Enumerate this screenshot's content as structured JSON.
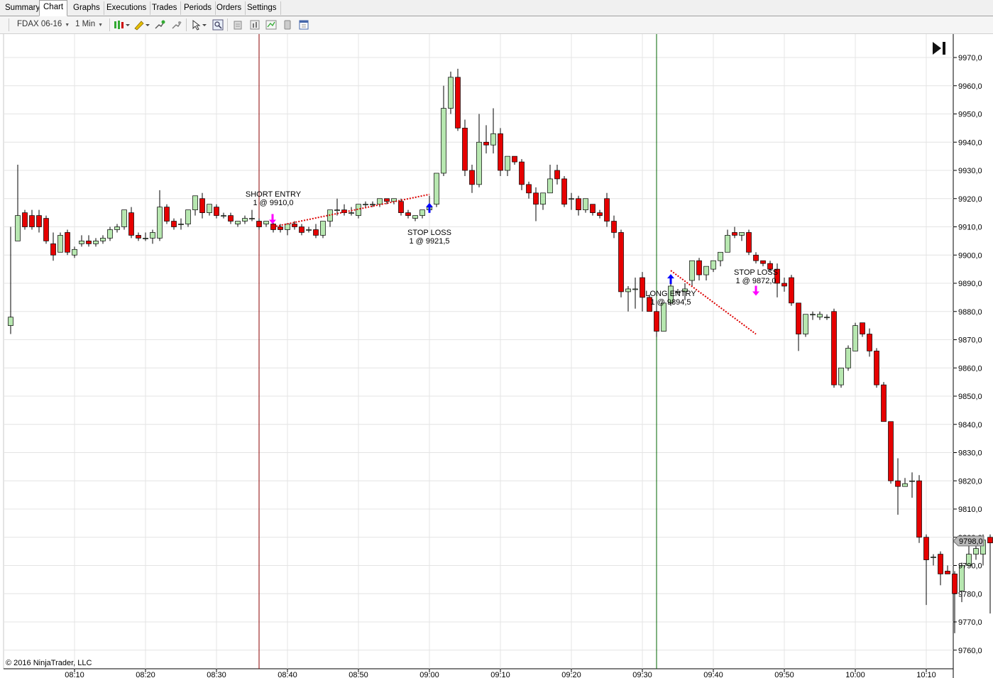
{
  "tabs": [
    {
      "label": "Summary",
      "active": false
    },
    {
      "label": "Chart",
      "active": true
    },
    {
      "label": "Graphs",
      "active": false
    },
    {
      "label": "Executions",
      "active": false
    },
    {
      "label": "Trades",
      "active": false
    },
    {
      "label": "Periods",
      "active": false
    },
    {
      "label": "Orders",
      "active": false
    },
    {
      "label": "Settings",
      "active": false
    }
  ],
  "toolbar": {
    "instrument": "FDAX 06-16",
    "interval": "1 Min",
    "icons": [
      "candlestick-style-icon",
      "pencil-draw-icon",
      "indicator-add-icon",
      "strategy-icon",
      "cursor-select-icon",
      "zoom-icon",
      "data-box-icon",
      "chart-properties-icon",
      "chart-trader-icon",
      "templates-icon",
      "panel-icon"
    ]
  },
  "chart": {
    "copyright": "© 2016 NinjaTrader, LLC",
    "colors": {
      "up": "#b7e7b0",
      "down": "#e60000",
      "short_line": "#8b0000",
      "long_line": "#006400",
      "trade_line": "#dd0000",
      "entry_arrow_short": "#ff00ff",
      "exit_arrow": "#0000ff"
    },
    "current_price": "9798,0",
    "price_ticks": [
      "9970,0",
      "9960,0",
      "9950,0",
      "9940,0",
      "9930,0",
      "9920,0",
      "9910,0",
      "9900,0",
      "9890,0",
      "9880,0",
      "9870,0",
      "9860,0",
      "9850,0",
      "9840,0",
      "9830,0",
      "9820,0",
      "9810,0",
      "9800,0",
      "9790,0",
      "9780,0",
      "9770,0",
      "9760,0"
    ],
    "time_ticks": [
      "08:10",
      "08:20",
      "08:30",
      "08:40",
      "08:50",
      "09:00",
      "09:10",
      "09:20",
      "09:30",
      "09:40",
      "09:50",
      "10:00",
      "10:10"
    ],
    "annotations": [
      {
        "label": "SHORT ENTRY",
        "detail": "1 @ 9910,0"
      },
      {
        "label": "STOP LOSS",
        "detail": "1 @ 9921,5"
      },
      {
        "label": "LONG ENTRY",
        "detail": "1 @ 9894,5"
      },
      {
        "label": "STOP LOSS",
        "detail": "1 @ 9872,0"
      }
    ],
    "trades": [
      {
        "side": "short",
        "entry_time": "08:38",
        "entry_price": 9910.0,
        "exit_time": "09:00",
        "exit_price": 9921.5
      },
      {
        "side": "long",
        "entry_time": "09:34",
        "entry_price": 9894.5,
        "exit_time": "09:46",
        "exit_price": 9872.0
      }
    ],
    "vertical_markers": [
      {
        "time": "08:36",
        "color": "#8b0000"
      },
      {
        "time": "09:32",
        "color": "#006400"
      }
    ]
  },
  "chart_data": {
    "type": "candlestick",
    "title": "",
    "xlabel": "",
    "ylabel": "",
    "ylim": [
      9757,
      9975
    ],
    "start_time": "08:01",
    "interval_minutes": 1,
    "candles": [
      [
        9875,
        9910,
        9878,
        9872
      ],
      [
        9905,
        9932,
        9914,
        9910
      ],
      [
        9915,
        9916,
        9910,
        9909
      ],
      [
        9914,
        9916,
        9910,
        9909
      ],
      [
        9914,
        9916,
        9910,
        9908
      ],
      [
        9913,
        9914,
        9905,
        9904
      ],
      [
        9904,
        9908,
        9900,
        9898
      ],
      [
        9901,
        9908,
        9907,
        9906
      ],
      [
        9908,
        9909,
        9901,
        9900
      ],
      [
        9900,
        9903,
        9902,
        9899
      ],
      [
        9904,
        9907,
        9905,
        9903
      ],
      [
        9905,
        9907,
        9904,
        9903
      ],
      [
        9904,
        9906,
        9905,
        9903
      ],
      [
        9905,
        9907,
        9906,
        9904
      ],
      [
        9906,
        9910,
        9909,
        9905
      ],
      [
        9909,
        9911,
        9910,
        9908
      ],
      [
        9910,
        9914,
        9916,
        9909
      ],
      [
        9915,
        9917,
        9907,
        9906
      ],
      [
        9907,
        9908,
        9906,
        9905
      ],
      [
        9906,
        9908,
        9906,
        9905
      ],
      [
        9906,
        9909,
        9908,
        9904
      ],
      [
        9906,
        9923,
        9917,
        9905
      ],
      [
        9917,
        9918,
        9912,
        9911
      ],
      [
        9912,
        9913,
        9910,
        9909
      ],
      [
        9911,
        9913,
        9911,
        9909
      ],
      [
        9911,
        9913,
        9916,
        9910
      ],
      [
        9916,
        9920,
        9921,
        9914
      ],
      [
        9920,
        9922,
        9915,
        9913
      ],
      [
        9915,
        9918,
        9918,
        9914
      ],
      [
        9917,
        9918,
        9914,
        9913
      ],
      [
        9914,
        9915,
        9914,
        9913
      ],
      [
        9914,
        9915,
        9912,
        9911
      ],
      [
        9911,
        9912,
        9912,
        9910
      ],
      [
        9912,
        9914,
        9913,
        9911
      ],
      [
        9913,
        9916,
        9913,
        9912
      ],
      [
        9912,
        9913,
        9910,
        9909
      ],
      [
        9911,
        9912,
        9912,
        9910
      ],
      [
        9911,
        9912,
        9909,
        9908
      ],
      [
        9910,
        9911,
        9909,
        9908
      ],
      [
        9909,
        9910,
        9911,
        9907
      ],
      [
        9911,
        9912,
        9910,
        9909
      ],
      [
        9910,
        9911,
        9908,
        9907
      ],
      [
        9909,
        9910,
        9909,
        9908
      ],
      [
        9909,
        9911,
        9907,
        9906
      ],
      [
        9907,
        9912,
        9912,
        9906
      ],
      [
        9912,
        9916,
        9916,
        9910
      ],
      [
        9916,
        9920,
        9916,
        9914
      ],
      [
        9916,
        9918,
        9915,
        9914
      ],
      [
        9915,
        9917,
        9915,
        9914
      ],
      [
        9914,
        9916,
        9918,
        9913
      ],
      [
        9918,
        9919,
        9918,
        9917
      ],
      [
        9918,
        9919,
        9918,
        9917
      ],
      [
        9918,
        9920,
        9920,
        9917
      ],
      [
        9920,
        9920,
        9919,
        9918
      ],
      [
        9919,
        9920,
        9920,
        9918
      ],
      [
        9919,
        9920,
        9915,
        9914
      ],
      [
        9915,
        9916,
        9914,
        9913
      ],
      [
        9913,
        9914,
        9914,
        9912
      ],
      [
        9914,
        9916,
        9916,
        9913
      ],
      [
        9916,
        9921,
        9917,
        9915
      ],
      [
        9918,
        9922,
        9929,
        9917
      ],
      [
        9929,
        9960,
        9952,
        9928
      ],
      [
        9952,
        9965,
        9963,
        9950
      ],
      [
        9963,
        9966,
        9945,
        9944
      ],
      [
        9945,
        9948,
        9930,
        9928
      ],
      [
        9930,
        9932,
        9925,
        9922
      ],
      [
        9925,
        9950,
        9940,
        9924
      ],
      [
        9940,
        9946,
        9939,
        9936
      ],
      [
        9939,
        9952,
        9943,
        9936
      ],
      [
        9943,
        9945,
        9930,
        9928
      ],
      [
        9930,
        9932,
        9935,
        9928
      ],
      [
        9935,
        9935,
        9933,
        9932
      ],
      [
        9933,
        9934,
        9925,
        9923
      ],
      [
        9925,
        9926,
        9922,
        9920
      ],
      [
        9922,
        9924,
        9918,
        9912
      ],
      [
        9918,
        9920,
        9922,
        9916
      ],
      [
        9922,
        9932,
        9927,
        9925
      ],
      [
        9930,
        9932,
        9927,
        9925
      ],
      [
        9927,
        9928,
        9918,
        9917
      ],
      [
        9920,
        9922,
        9920,
        9916
      ],
      [
        9920,
        9921,
        9916,
        9914
      ],
      [
        9916,
        9918,
        9920,
        9915
      ],
      [
        9918,
        9918,
        9915,
        9914
      ],
      [
        9915,
        9916,
        9914,
        9913
      ],
      [
        9920,
        9922,
        9912,
        9910
      ],
      [
        9912,
        9914,
        9908,
        9906
      ],
      [
        9908,
        9909,
        9887,
        9885
      ],
      [
        9887,
        9889,
        9888,
        9880
      ],
      [
        9888,
        9892,
        9888,
        9881
      ],
      [
        9892,
        9894,
        9885,
        9880
      ],
      [
        9885,
        9886,
        9880,
        9880
      ],
      [
        9880,
        9884,
        9873,
        9871
      ],
      [
        9873,
        9880,
        9883,
        9873
      ],
      [
        9883,
        9890,
        9889,
        9882
      ],
      [
        9887,
        9888,
        9887,
        9886
      ],
      [
        9887,
        9890,
        9888,
        9884
      ],
      [
        9891,
        9897,
        9898,
        9889
      ],
      [
        9898,
        9899,
        9893,
        9891
      ],
      [
        9893,
        9896,
        9896,
        9891
      ],
      [
        9895,
        9897,
        9898,
        9894
      ],
      [
        9898,
        9901,
        9901,
        9896
      ],
      [
        9901,
        9909,
        9907,
        9903
      ],
      [
        9908,
        9910,
        9907,
        9906
      ],
      [
        9907,
        9908,
        9908,
        9905
      ],
      [
        9908,
        9909,
        9901,
        9900
      ],
      [
        9900,
        9901,
        9898,
        9897
      ],
      [
        9898,
        9898,
        9897,
        9896
      ],
      [
        9897,
        9898,
        9895,
        9894
      ],
      [
        9895,
        9897,
        9890,
        9885
      ],
      [
        9890,
        9892,
        9889,
        9887
      ],
      [
        9892,
        9893,
        9883,
        9882
      ],
      [
        9883,
        9883,
        9872,
        9866
      ],
      [
        9872,
        9878,
        9879,
        9871
      ],
      [
        9879,
        9880,
        9879,
        9877
      ],
      [
        9878,
        9880,
        9879,
        9877
      ],
      [
        9878,
        9879,
        9878,
        9877
      ],
      [
        9880,
        9881,
        9854,
        9853
      ],
      [
        9854,
        9855,
        9860,
        9853
      ],
      [
        9860,
        9868,
        9867,
        9859
      ],
      [
        9866,
        9876,
        9875,
        9866
      ],
      [
        9876,
        9876,
        9872,
        9871
      ],
      [
        9872,
        9874,
        9866,
        9864
      ],
      [
        9866,
        9867,
        9854,
        9853
      ],
      [
        9854,
        9855,
        9841,
        9841
      ],
      [
        9841,
        9841,
        9820,
        9819
      ],
      [
        9820,
        9828,
        9818,
        9808
      ],
      [
        9818,
        9821,
        9819,
        9818
      ],
      [
        9820,
        9823,
        9820,
        9814
      ],
      [
        9820,
        9822,
        9800,
        9798
      ],
      [
        9800,
        9801,
        9792,
        9776
      ],
      [
        9793,
        9794,
        9793,
        9790
      ],
      [
        9794,
        9795,
        9787,
        9783
      ],
      [
        9788,
        9790,
        9787,
        9787
      ],
      [
        9787,
        9788,
        9780,
        9766
      ],
      [
        9781,
        9791,
        9790,
        9777
      ],
      [
        9790,
        9798,
        9794,
        9790
      ],
      [
        9794,
        9797,
        9796,
        9792
      ],
      [
        9794,
        9801,
        9799,
        9790
      ],
      [
        9800,
        9801,
        9798,
        9773
      ]
    ]
  }
}
